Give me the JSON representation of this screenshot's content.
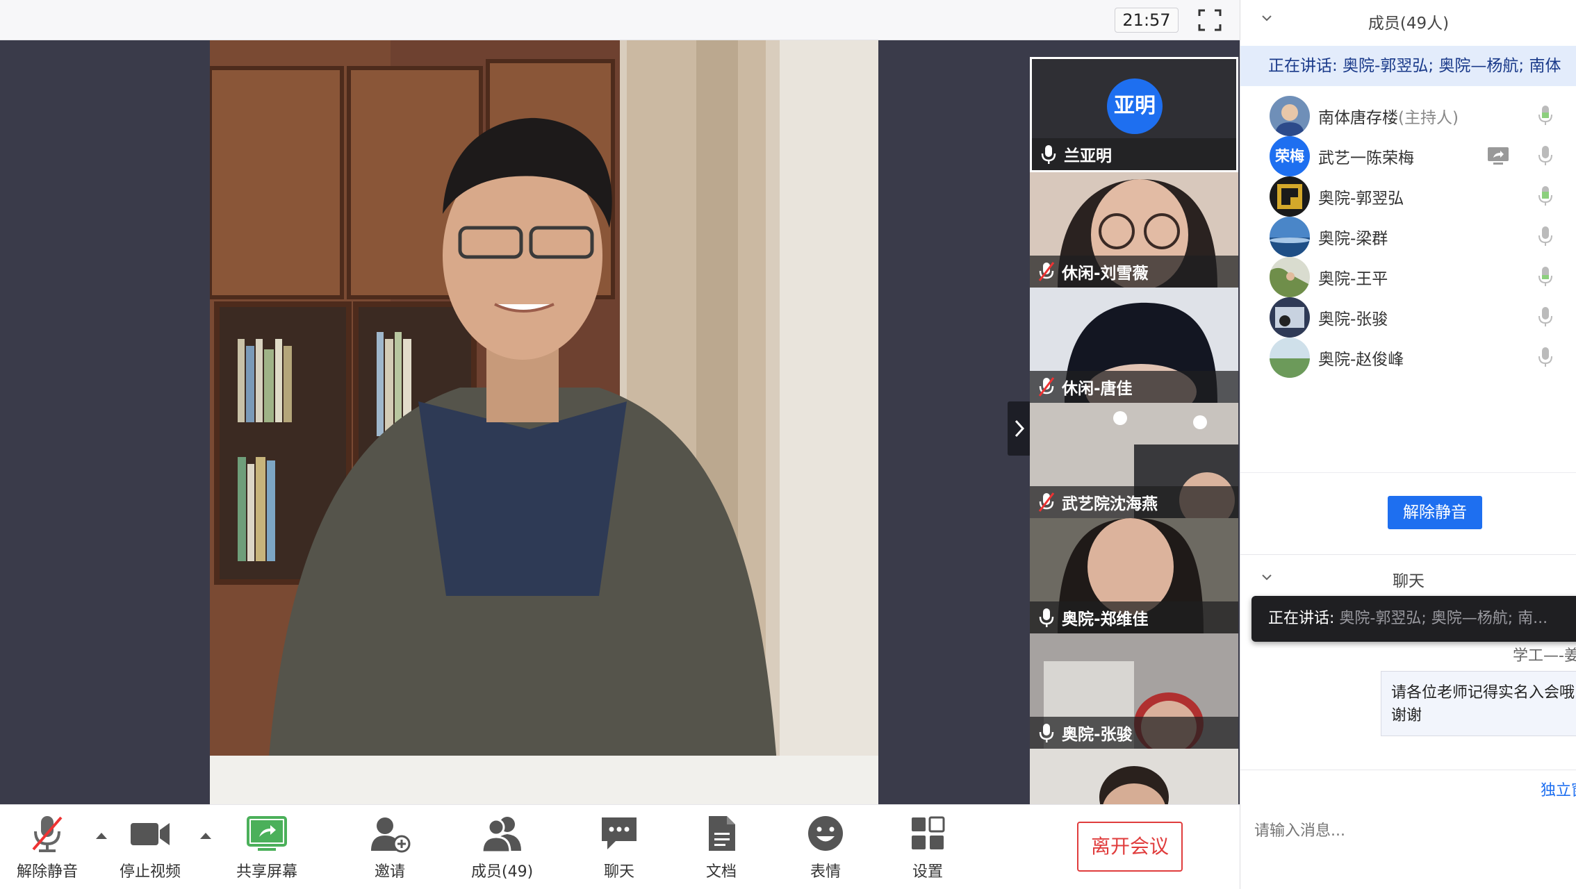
{
  "topbar": {
    "clock": "21:57",
    "fullscreen_icon": "fullscreen-icon"
  },
  "thumbnails": [
    {
      "name": "兰亚明",
      "avatar_text": "亚明",
      "muted": false,
      "active": true
    },
    {
      "name": "休闲-刘雪薇",
      "muted": true
    },
    {
      "name": "休闲-唐佳",
      "muted": true
    },
    {
      "name": "武艺院沈海燕",
      "muted": true
    },
    {
      "name": "奥院-郑维佳",
      "muted": false
    },
    {
      "name": "奥院-张骏",
      "muted": false
    }
  ],
  "toolbar": {
    "unmute": "解除静音",
    "stop_video": "停止视频",
    "share_screen": "共享屏幕",
    "invite": "邀请",
    "members": "成员(49)",
    "chat": "聊天",
    "docs": "文档",
    "emoji": "表情",
    "settings": "设置",
    "leave": "离开会议"
  },
  "panel": {
    "members_title": "成员(49人)",
    "speaking_label": "正在讲话: 奥院-郭翌弘; 奥院—杨航; 南体",
    "members": [
      {
        "name": "南体唐存楼",
        "role": "(主持人)",
        "avatar_text": ""
      },
      {
        "name": "武艺一陈荣梅",
        "role": "",
        "avatar_text": "荣梅"
      },
      {
        "name": "奥院-郭翌弘",
        "role": "",
        "avatar_text": ""
      },
      {
        "name": "奥院-梁群",
        "role": "",
        "avatar_text": ""
      },
      {
        "name": "奥院-王平",
        "role": "",
        "avatar_text": ""
      },
      {
        "name": "奥院-张骏",
        "role": "",
        "avatar_text": ""
      },
      {
        "name": "奥院-赵俊峰",
        "role": "",
        "avatar_text": ""
      }
    ],
    "unmute_all": "解除静音",
    "chat_title": "聊天",
    "tooltip_prefix": "正在讲话:",
    "tooltip_names": " 奥院-郭翌弘; 奥院—杨航; 南...",
    "chat_sender": "学工—-姜",
    "chat_message_line1": "请各位老师记得实名入会哦",
    "chat_message_line2": "谢谢",
    "chat_link": "独立窗",
    "chat_placeholder": "请输入消息..."
  },
  "colors": {
    "accent": "#1e6ff0",
    "leave": "#e03c3c",
    "stage": "#3a3b4a"
  }
}
